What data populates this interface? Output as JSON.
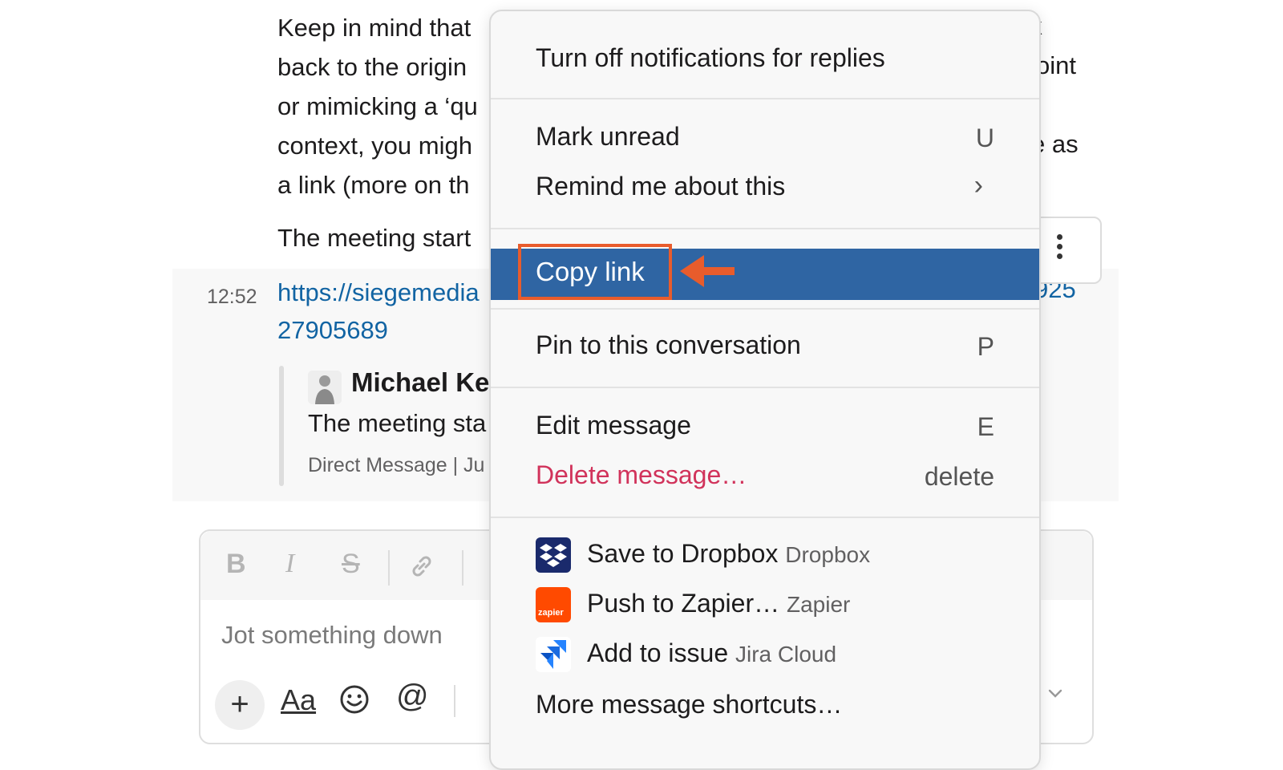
{
  "background_message": {
    "lines": [
      "Keep in mind that",
      "back to the origin",
      "or mimicking a ‘qu",
      "context, you migh",
      "a link (more on th"
    ],
    "meeting_line": "The meeting start",
    "timestamp": "12:52",
    "link_line1": "https://siegemedia",
    "link_line2": "27905689",
    "link_right": "925",
    "right_fragments": [
      "k",
      "oint",
      "e as",
      "e as"
    ],
    "quote": {
      "name": "Michael Ke",
      "body": "The meeting sta",
      "meta": "Direct Message | Ju"
    }
  },
  "composer": {
    "format_bold": "B",
    "format_italic": "I",
    "format_strike": "S",
    "placeholder": "Jot something down",
    "plus": "+",
    "text_format": "Aa",
    "mention": "@"
  },
  "menu": {
    "turn_off_notifications": "Turn off notifications for replies",
    "mark_unread": "Mark unread",
    "mark_unread_shortcut": "U",
    "remind_me": "Remind me about this",
    "remind_me_chevron": "›",
    "copy_link": "Copy link",
    "pin": "Pin to this conversation",
    "pin_shortcut": "P",
    "edit": "Edit message",
    "edit_shortcut": "E",
    "delete": "Delete message…",
    "delete_shortcut": "delete",
    "apps": [
      {
        "action": "Save to Dropbox",
        "source": "Dropbox",
        "icon": "dropbox-icon"
      },
      {
        "action": "Push to Zapier…",
        "source": "Zapier",
        "icon": "zapier-icon",
        "icon_text": "zapier"
      },
      {
        "action": "Add to issue",
        "source": "Jira Cloud",
        "icon": "jira-icon"
      }
    ],
    "more_shortcuts": "More message shortcuts…"
  },
  "colors": {
    "highlight": "#2f65a3",
    "annotation": "#e85c2c",
    "danger": "#d1335b",
    "link": "#1264a3"
  }
}
